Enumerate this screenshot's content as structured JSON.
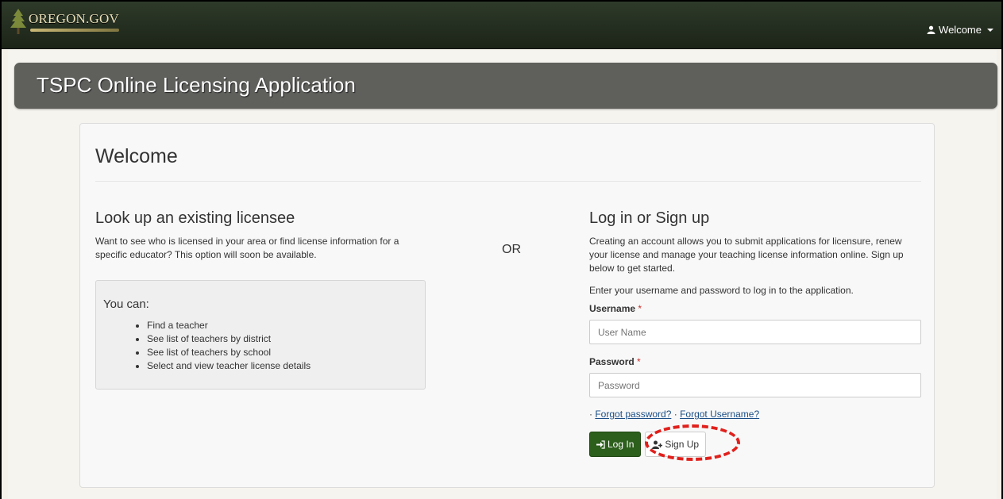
{
  "header": {
    "logo_text": "OREGON.GOV",
    "user_menu_label": "Welcome"
  },
  "banner": {
    "title": "TSPC Online Licensing Application"
  },
  "panel": {
    "title": "Welcome",
    "lookup": {
      "heading": "Look up an existing licensee",
      "description": "Want to see who is licensed in your area or find license information for a specific educator? This option will soon be available.",
      "you_can_title": "You can:",
      "items": [
        "Find a teacher",
        "See list of teachers by district",
        "See list of teachers by school",
        "Select and view teacher license details"
      ]
    },
    "or_label": "OR",
    "login": {
      "heading": "Log in or Sign up",
      "description": "Creating an account allows you to submit applications for licensure, renew your license and manage your teaching license information online. Sign up below to get started.",
      "instruction": "Enter your username and password to log in to the application.",
      "username_label": "Username",
      "username_placeholder": "User Name",
      "password_label": "Password",
      "password_placeholder": "Password",
      "required_marker": "*",
      "forgot_password": "Forgot password?",
      "forgot_username": "Forgot Username?",
      "link_separator": "·",
      "login_button": "Log In",
      "signup_button": "Sign Up"
    }
  },
  "colors": {
    "topbar": "#1c2418",
    "banner": "#5f5f5c",
    "login_button": "#2c5e1c",
    "highlight": "#e0201c",
    "link": "#1b4e86"
  }
}
